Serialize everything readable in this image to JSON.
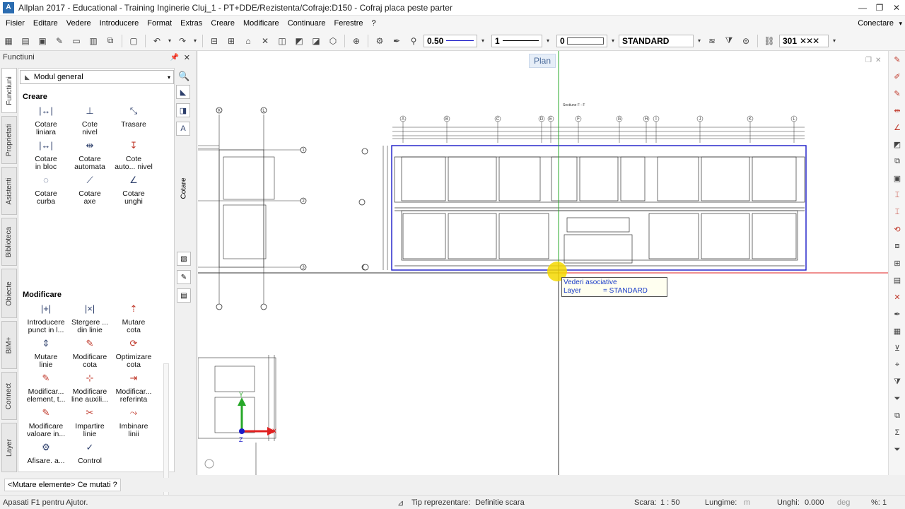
{
  "window": {
    "title": "Allplan 2017 - Educational - Training Inginerie Cluj_1 - PT+DDE/Rezistenta/Cofraje:D150 - Cofraj placa peste parter",
    "app_icon": "A"
  },
  "menu": {
    "items": [
      "Fisier",
      "Editare",
      "Vedere",
      "Introducere",
      "Format",
      "Extras",
      "Creare",
      "Modificare",
      "Continuare",
      "Ferestre",
      "?"
    ],
    "conectare": "Conectare"
  },
  "toolbar": {
    "pen_value": "0.50",
    "line_value": "1",
    "color_value": "0",
    "layer_value": "STANDARD",
    "hatch_value": "301"
  },
  "left_panel": {
    "title": "Functiuni",
    "module": "Modul general",
    "vertical_tabs": [
      "Functiuni",
      "Proprietati",
      "Asistenti",
      "Biblioteca",
      "Obiecte",
      "BIM+",
      "Connect",
      "Layer"
    ],
    "side_label": "Cotare",
    "creare_title": "Creare",
    "creare_tools": [
      {
        "line1": "Cotare",
        "line2": "liniara",
        "icon": "|↔|"
      },
      {
        "line1": "Cote",
        "line2": "nivel",
        "icon": "⊥"
      },
      {
        "line1": "Trasare",
        "line2": "",
        "icon": "⤡"
      },
      {
        "line1": "Cotare",
        "line2": "in bloc",
        "icon": "|↔|"
      },
      {
        "line1": "Cotare",
        "line2": "automata",
        "icon": "⇹"
      },
      {
        "line1": "Cote",
        "line2": "auto... nivel",
        "icon": "↧"
      },
      {
        "line1": "Cotare",
        "line2": "curba",
        "icon": "◌"
      },
      {
        "line1": "Cotare",
        "line2": "axe",
        "icon": "⟋"
      },
      {
        "line1": "Cotare",
        "line2": "unghi",
        "icon": "∠"
      }
    ],
    "modificare_title": "Modificare",
    "modificare_tools": [
      {
        "line1": "Introducere",
        "line2": "punct in l...",
        "icon": "|+|"
      },
      {
        "line1": "Stergere ...",
        "line2": "din linie",
        "icon": "|×|"
      },
      {
        "line1": "Mutare",
        "line2": "cota",
        "icon": "⇡"
      },
      {
        "line1": "Mutare",
        "line2": "linie",
        "icon": "⇕"
      },
      {
        "line1": "Modificare",
        "line2": "cota",
        "icon": "✎"
      },
      {
        "line1": "Optimizare",
        "line2": "cota",
        "icon": "⟳"
      },
      {
        "line1": "Modificar...",
        "line2": "element, t...",
        "icon": "✎"
      },
      {
        "line1": "Modificare",
        "line2": "line auxili...",
        "icon": "⊹"
      },
      {
        "line1": "Modificar...",
        "line2": "referinta",
        "icon": "⇥"
      },
      {
        "line1": "Modificare",
        "line2": "valoare in...",
        "icon": "✎"
      },
      {
        "line1": "Impartire",
        "line2": "linie",
        "icon": "✂"
      },
      {
        "line1": "Imbinare",
        "line2": "linii",
        "icon": "⤳"
      },
      {
        "line1": "Afisare. a...",
        "line2": "",
        "icon": "⚙"
      },
      {
        "line1": "Control",
        "line2": "",
        "icon": "✓"
      }
    ]
  },
  "canvas": {
    "view_label": "Plan",
    "section_label": "Sectiune F - F",
    "tooltip_line1": "Vederi asociative",
    "tooltip_line2_key": "Layer",
    "tooltip_line2_val": "= STANDARD",
    "axis_top_labels": [
      "A",
      "B",
      "C",
      "D",
      "E",
      "F",
      "G",
      "H",
      "I",
      "J",
      "K",
      "L"
    ],
    "axis_left_labels": [
      "1",
      "2",
      "3"
    ],
    "left_axis_labels": [
      "K",
      "L"
    ],
    "gizmo_axes": [
      "X",
      "Y",
      "Z"
    ]
  },
  "command_line": {
    "prompt": "<Mutare elemente> Ce mutati ?"
  },
  "status": {
    "help": "Apasati F1 pentru Ajutor.",
    "tip_label": "Tip reprezentare:",
    "tip_value": "Definitie scara",
    "scara_label": "Scara:",
    "scara_value": "1 : 50",
    "lungime_label": "Lungime:",
    "lungime_unit": "m",
    "unghi_label": "Unghi:",
    "unghi_value": "0.000",
    "unghi_unit": "deg",
    "percent_label": "%:",
    "percent_value": "1"
  },
  "colors": {
    "building_outline": "#1a1ac8",
    "cursor_highlight": "#f5d800",
    "axis_green": "#27a829",
    "axis_red": "#e02020"
  }
}
